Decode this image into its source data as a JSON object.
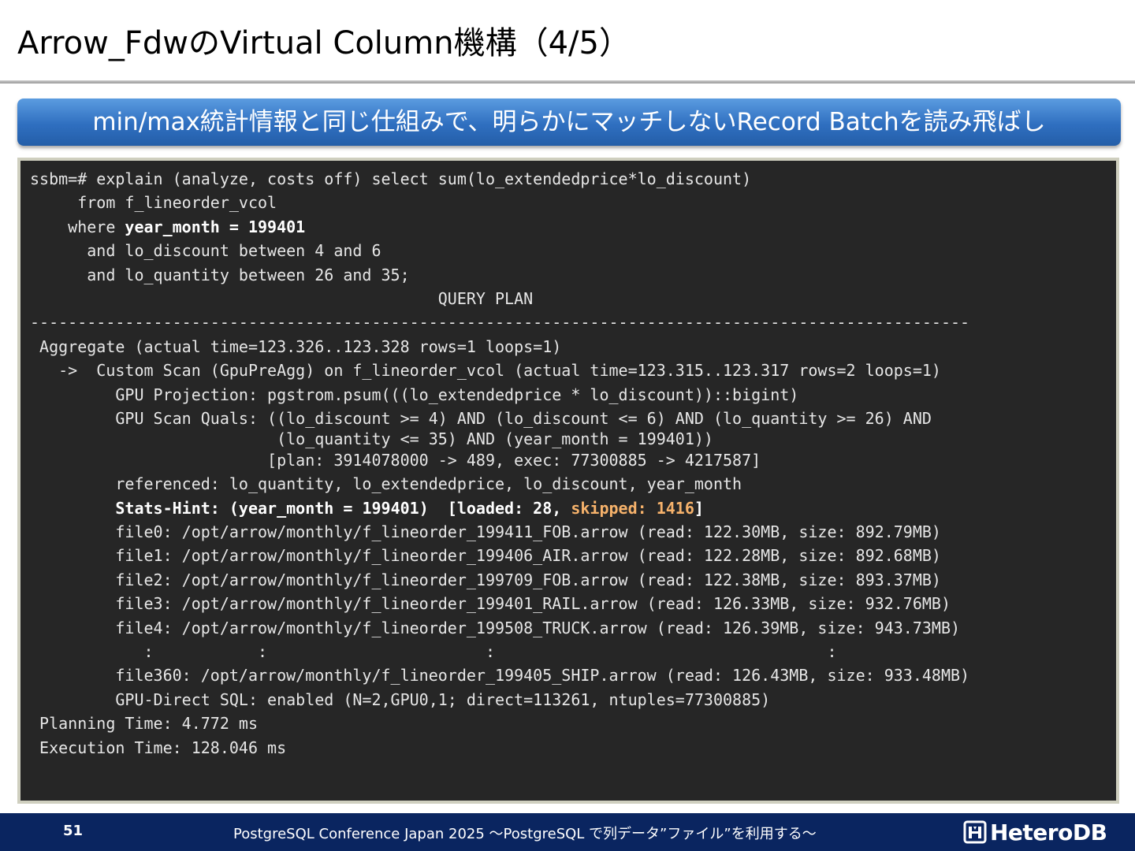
{
  "slide": {
    "title": "Arrow_FdwのVirtual Column機構（4/5）",
    "banner": "min/max統計情報と同じ仕組みで、明らかにマッチしないRecord Batchを読み飛ばし"
  },
  "terminal": {
    "lines": [
      "ssbm=# explain (analyze, costs off) select sum(lo_extendedprice*lo_discount)",
      "     from f_lineorder_vcol",
      "    where ",
      "      and lo_discount between 4 and 6",
      "      and lo_quantity between 26 and 35;",
      "                                           QUERY PLAN",
      "---------------------------------------------------------------------------------------------------",
      " Aggregate (actual time=123.326..123.328 rows=1 loops=1)",
      "   ->  Custom Scan (GpuPreAgg) on f_lineorder_vcol (actual time=123.315..123.317 rows=2 loops=1)",
      "         GPU Projection: pgstrom.psum(((lo_extendedprice * lo_discount))::bigint)",
      "         GPU Scan Quals: ((lo_discount >= 4) AND (lo_discount <= 6) AND (lo_quantity >= 26) AND",
      "                          (lo_quantity <= 35) AND (year_month = 199401))",
      "                         [plan: 3914078000 -> 489, exec: 77300885 -> 4217587]",
      "         referenced: lo_quantity, lo_extendedprice, lo_discount, year_month",
      "         ",
      "         file0: /opt/arrow/monthly/f_lineorder_199411_FOB.arrow (read: 122.30MB, size: 892.79MB)",
      "         file1: /opt/arrow/monthly/f_lineorder_199406_AIR.arrow (read: 122.28MB, size: 892.68MB)",
      "         file2: /opt/arrow/monthly/f_lineorder_199709_FOB.arrow (read: 122.38MB, size: 893.37MB)",
      "         file3: /opt/arrow/monthly/f_lineorder_199401_RAIL.arrow (read: 126.33MB, size: 932.76MB)",
      "         file4: /opt/arrow/monthly/f_lineorder_199508_TRUCK.arrow (read: 126.39MB, size: 943.73MB)",
      "            :           :                       :                                   :",
      "         file360: /opt/arrow/monthly/f_lineorder_199405_SHIP.arrow (read: 126.43MB, size: 933.48MB)",
      "         GPU-Direct SQL: enabled (N=2,GPU0,1; direct=113261, ntuples=77300885)",
      " Planning Time: 4.772 ms",
      " Execution Time: 128.046 ms"
    ],
    "where_highlight": "year_month = 199401",
    "stats_hint_label": "Stats-Hint: (year_month = 199401)  [loaded: 28, ",
    "stats_hint_skipped": "skipped: 1416",
    "stats_hint_close": "]"
  },
  "footer": {
    "page_number": "51",
    "text": "PostgreSQL Conference Japan 2025 ～PostgreSQL で列データ”ファイル”を利用する～",
    "logo_text": "HeteroDB"
  }
}
